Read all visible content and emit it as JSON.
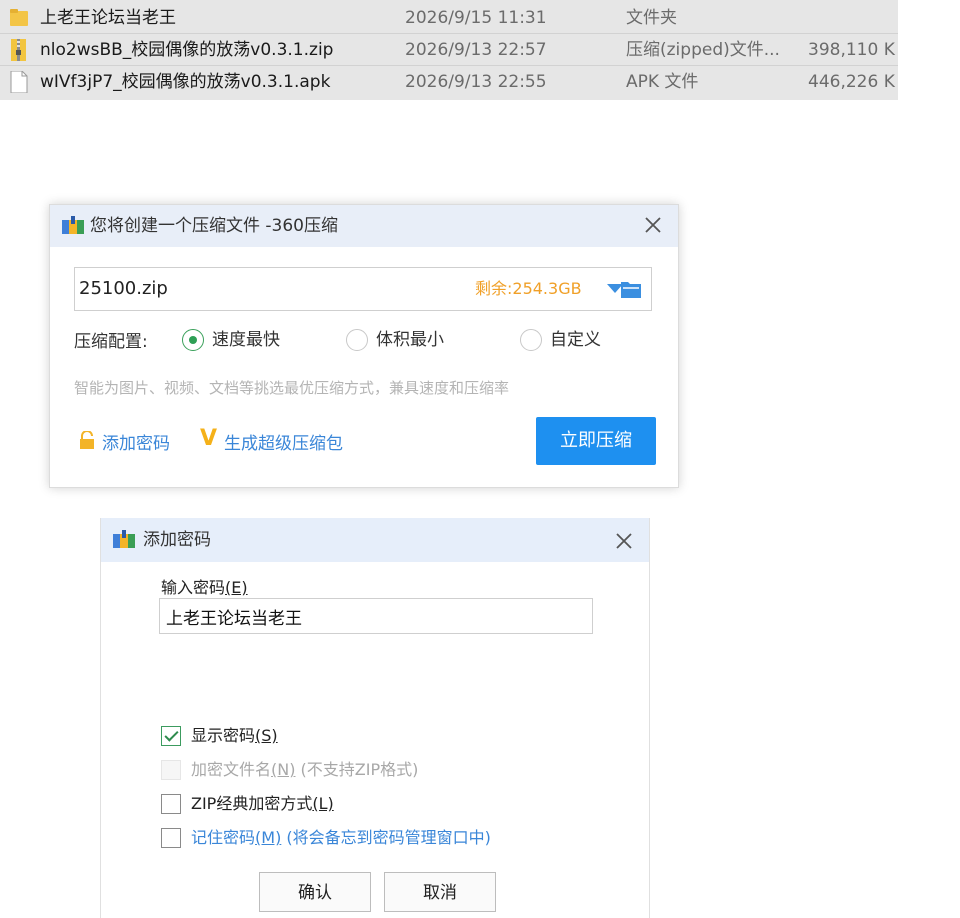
{
  "file_list": {
    "rows": [
      {
        "icon": "folder-icon",
        "name": "上老王论坛当老王",
        "date": "2026/9/15 11:31",
        "type": "文件夹",
        "size": ""
      },
      {
        "icon": "zip-file-icon",
        "name": "nlo2wsBB_校园偶像的放荡v0.3.1.zip",
        "date": "2026/9/13 22:57",
        "type": "压缩(zipped)文件...",
        "size": "398,110 K"
      },
      {
        "icon": "file-icon",
        "name": "wIVf3jP7_校园偶像的放荡v0.3.1.apk",
        "date": "2026/9/13 22:55",
        "type": "APK 文件",
        "size": "446,226 K"
      }
    ]
  },
  "compress_dialog": {
    "title": "您将创建一个压缩文件 -360压缩",
    "path_value": "25100.zip",
    "remaining": "剩余:254.3GB",
    "config_label": "压缩配置:",
    "options": [
      {
        "label": "速度最快",
        "selected": true
      },
      {
        "label": "体积最小",
        "selected": false
      },
      {
        "label": "自定义",
        "selected": false
      }
    ],
    "hint": "智能为图片、视频、文档等挑选最优压缩方式，兼具速度和压缩率",
    "add_password_link": "添加密码",
    "super_mark": "V",
    "super_link": "生成超级压缩包",
    "compress_button": "立即压缩",
    "accent_color": "#1e90f0",
    "remaining_color": "#f0a028"
  },
  "password_dialog": {
    "title": "添加密码",
    "input_label": "输入密码",
    "input_label_key": "(E)",
    "password_value": "上老王论坛当老王",
    "show_password": {
      "label": "显示密码",
      "key": "(S)",
      "checked": true
    },
    "encrypt_filenames": {
      "label": "加密文件名",
      "key": "(N)",
      "note": " (不支持ZIP格式)",
      "disabled": true
    },
    "zip_classic": {
      "label": "ZIP经典加密方式",
      "key": "(L)",
      "checked": false
    },
    "remember_password": {
      "label": "记住密码",
      "key": "(M)",
      "note": " (将会备忘到密码管理窗口中)",
      "checked": false
    },
    "ok_button": "确认",
    "cancel_button": "取消"
  }
}
